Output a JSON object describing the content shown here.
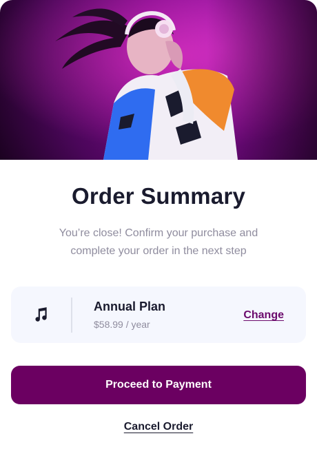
{
  "hero": {
    "image": "woman-with-headphones-illustration"
  },
  "title": "Order Summary",
  "subtitle": "You’re close! Confirm your purchase and complete your order in the next step",
  "plan": {
    "icon": "music-note-icon",
    "name": "Annual Plan",
    "price": "$58.99 / year",
    "change_label": "Change"
  },
  "actions": {
    "proceed_label": "Proceed to Payment",
    "cancel_label": "Cancel Order"
  },
  "colors": {
    "primary": "#6b0061",
    "link": "#6b0a6c",
    "heading": "#1a1b2e",
    "muted": "#8f8c9e",
    "plan_background": "#f5f7fe"
  }
}
